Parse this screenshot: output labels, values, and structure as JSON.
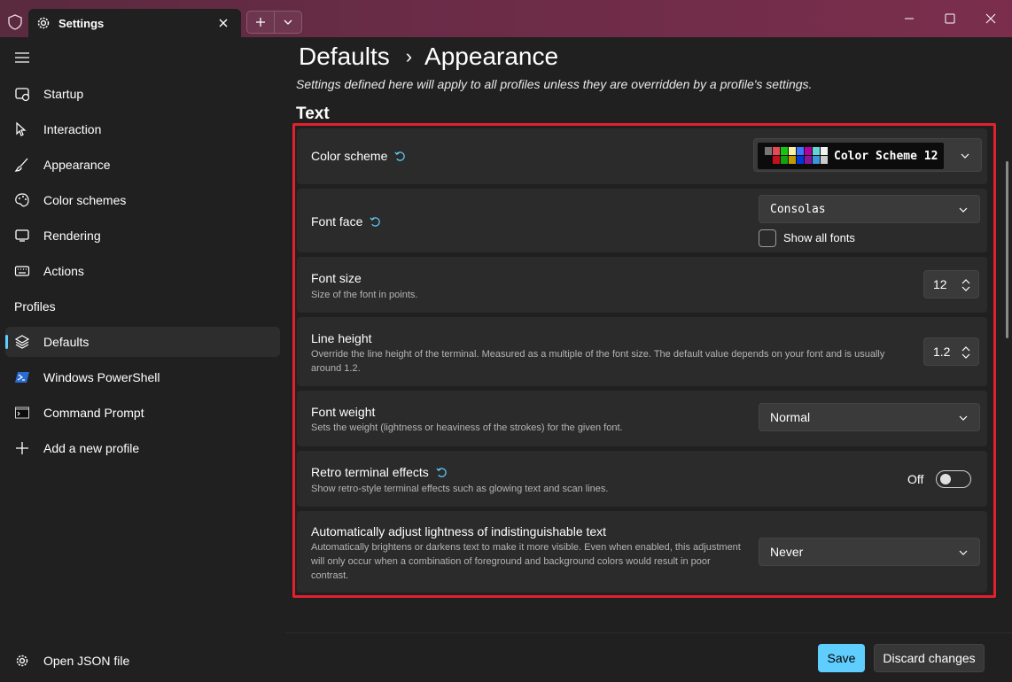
{
  "window": {
    "tab_title": "Settings",
    "new_tab_icon": "plus-icon",
    "dropdown_icon": "chevron-down-icon",
    "controls": [
      "minimize-icon",
      "maximize-icon",
      "close-icon"
    ]
  },
  "sidebar": {
    "items": [
      {
        "label": "Startup",
        "icon": "startup-icon"
      },
      {
        "label": "Interaction",
        "icon": "interaction-icon"
      },
      {
        "label": "Appearance",
        "icon": "paintbrush-icon"
      },
      {
        "label": "Color schemes",
        "icon": "palette-icon"
      },
      {
        "label": "Rendering",
        "icon": "monitor-icon"
      },
      {
        "label": "Actions",
        "icon": "keyboard-icon"
      }
    ],
    "profiles_header": "Profiles",
    "profiles": [
      {
        "label": "Defaults",
        "icon": "layers-icon",
        "active": true
      },
      {
        "label": "Windows PowerShell",
        "icon": "powershell-icon"
      },
      {
        "label": "Command Prompt",
        "icon": "cmd-icon"
      },
      {
        "label": "Add a new profile",
        "icon": "plus-icon"
      }
    ],
    "open_json": "Open JSON file"
  },
  "main": {
    "breadcrumb": [
      "Defaults",
      "Appearance"
    ],
    "subtitle": "Settings defined here will apply to all profiles unless they are overridden by a profile's settings.",
    "section": "Text",
    "settings": {
      "color_scheme": {
        "label": "Color scheme",
        "value": "Color Scheme 12"
      },
      "font_face": {
        "label": "Font face",
        "value": "Consolas",
        "checkbox_label": "Show all fonts",
        "checked": false
      },
      "font_size": {
        "label": "Font size",
        "description": "Size of the font in points.",
        "value": "12"
      },
      "line_height": {
        "label": "Line height",
        "description": "Override the line height of the terminal. Measured as a multiple of the font size. The default value depends on your font and is usually around 1.2.",
        "value": "1.2"
      },
      "font_weight": {
        "label": "Font weight",
        "description": "Sets the weight (lightness or heaviness of the strokes) for the given font.",
        "value": "Normal"
      },
      "retro": {
        "label": "Retro terminal effects",
        "description": "Show retro-style terminal effects such as glowing text and scan lines.",
        "state": "Off"
      },
      "adjust_lightness": {
        "label": "Automatically adjust lightness of indistinguishable text",
        "description": "Automatically brightens or darkens text to make it more visible. Even when enabled, this adjustment will only occur when a combination of foreground and background colors would result in poor contrast.",
        "value": "Never"
      }
    },
    "swatch_colors": [
      "#0c0c0c",
      "#c50f1f",
      "#13a10e",
      "#c19c00",
      "#0037da",
      "#881798",
      "#3a96dd",
      "#cccccc",
      "#767676",
      "#e74856",
      "#16c60c",
      "#f9f1a5",
      "#3b78ff",
      "#b4009e",
      "#61d6d6",
      "#f2f2f2"
    ]
  },
  "footer": {
    "save": "Save",
    "discard": "Discard changes"
  },
  "colors": {
    "accent": "#60cdff",
    "highlight": "#e3202d"
  }
}
